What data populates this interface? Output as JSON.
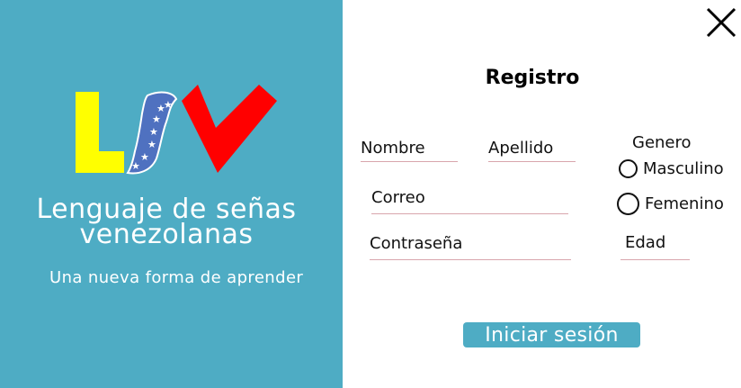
{
  "brand": {
    "logo_icon": "lsv-logo-icon",
    "title": "Lenguaje de señas venezolanas",
    "subtitle": "Una nueva forma de aprender",
    "colors": {
      "panel": "#4eacc4",
      "logo_yellow": "#ffff00",
      "logo_blue": "#4f71c0",
      "logo_red": "#ff0000"
    }
  },
  "form": {
    "title": "Registro",
    "fields": {
      "nombre": "Nombre",
      "apellido": "Apellido",
      "correo": "Correo",
      "contrasena": "Contraseña",
      "edad": "Edad"
    },
    "gender": {
      "label": "Genero",
      "options": [
        "Masculino",
        "Femenino"
      ]
    },
    "submit_label": "Iniciar sesión"
  },
  "window": {
    "close_icon": "close-icon"
  }
}
